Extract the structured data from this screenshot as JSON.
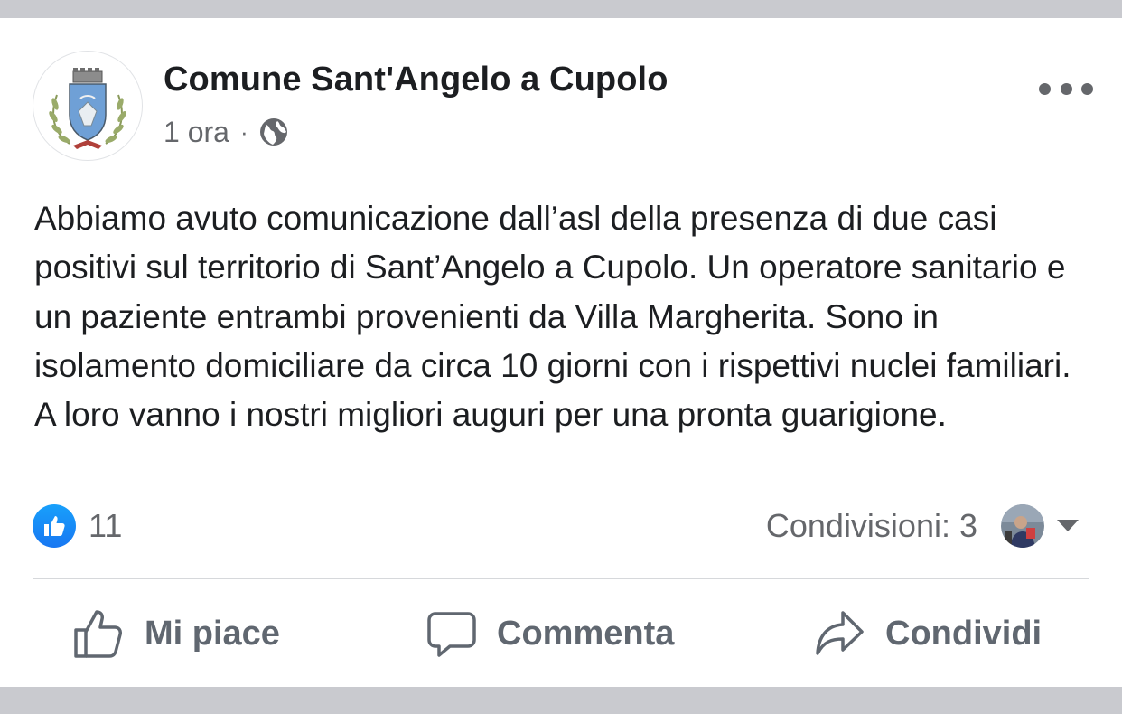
{
  "post": {
    "author": "Comune Sant'Angelo a Cupolo",
    "time": "1 ora",
    "separator": "·",
    "privacy_icon": "globe-icon",
    "text": "Abbiamo avuto comunicazione dall’asl della presenza di due casi positivi sul territorio di Sant’Angelo a Cupolo. Un operatore sanitario e un paziente entrambi provenienti da Villa Margherita. Sono in isolamento domiciliare da circa 10 giorni con i rispettivi nuclei familiari. A loro vanno i nostri migliori auguri per una pronta guarigione."
  },
  "reactions": {
    "like_count": "11",
    "shares_label": "Condivisioni: 3"
  },
  "actions": {
    "like": "Mi piace",
    "comment": "Commenta",
    "share": "Condividi"
  },
  "colors": {
    "like_blue": "#1877f2",
    "secondary_text": "#65676b",
    "action_text": "#606770",
    "band_gray": "#c9cacf"
  }
}
